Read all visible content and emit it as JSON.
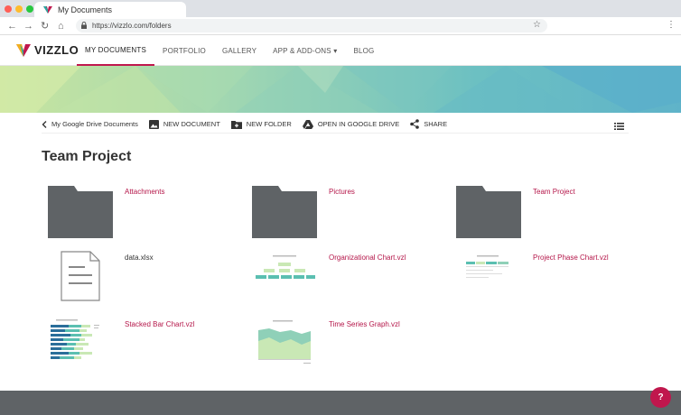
{
  "browser": {
    "tab_title": "My Documents",
    "url": "https://vizzlo.com/folders",
    "colors": {
      "close": "#ff5f57",
      "min": "#febc2e",
      "max": "#28c840"
    }
  },
  "app": {
    "logo": "VIZZLO",
    "menu": [
      {
        "label": "MY DOCUMENTS",
        "active": true
      },
      {
        "label": "PORTFOLIO"
      },
      {
        "label": "GALLERY"
      },
      {
        "label": "APP & ADD-ONS ▾"
      },
      {
        "label": "BLOG"
      }
    ],
    "accent": "#c0174d"
  },
  "toolbar": {
    "back": "My Google Drive Documents",
    "new_document": "NEW DOCUMENT",
    "new_folder": "NEW FOLDER",
    "open_drive": "OPEN IN GOOGLE DRIVE",
    "share": "SHARE"
  },
  "folder_title": "Team Project",
  "items": [
    {
      "name": "Attachments",
      "kind": "folder"
    },
    {
      "name": "Pictures",
      "kind": "folder"
    },
    {
      "name": "Team Project",
      "kind": "folder"
    },
    {
      "name": "data.xlsx",
      "kind": "file"
    },
    {
      "name": "Organizational Chart.vzl",
      "kind": "org-chart"
    },
    {
      "name": "Project Phase Chart.vzl",
      "kind": "phase-chart"
    },
    {
      "name": "Stacked Bar Chart.vzl",
      "kind": "stacked-bar"
    },
    {
      "name": "Time Series Graph.vzl",
      "kind": "time-series"
    }
  ],
  "help_label": "?"
}
